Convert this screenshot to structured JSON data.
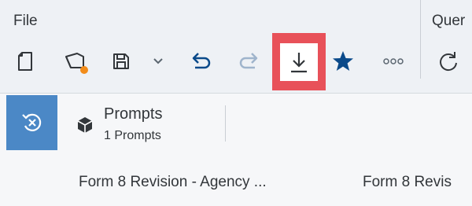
{
  "toolbar": {
    "groups": [
      "File",
      "Quer"
    ],
    "tools": [
      {
        "name": "new-document",
        "icon": "new-document-icon"
      },
      {
        "name": "open-document",
        "icon": "open-folder-icon"
      },
      {
        "name": "save",
        "icon": "save-icon"
      },
      {
        "name": "save-options",
        "icon": "chevron-down-icon"
      },
      {
        "name": "undo",
        "icon": "undo-icon"
      },
      {
        "name": "redo",
        "icon": "redo-icon"
      },
      {
        "name": "download",
        "icon": "download-icon"
      },
      {
        "name": "favorite",
        "icon": "star-icon"
      },
      {
        "name": "more",
        "icon": "more-icon"
      },
      {
        "name": "refresh",
        "icon": "refresh-icon"
      }
    ],
    "highlight_color": "#e85159",
    "notification_color": "#f28c1a"
  },
  "prompts": {
    "title": "Prompts",
    "count_label": "1 Prompts",
    "reset_button_color": "#4b88c6"
  },
  "tabs": [
    {
      "label": "Form 8 Revision - Agency ..."
    },
    {
      "label": "Form 8 Revis"
    }
  ]
}
